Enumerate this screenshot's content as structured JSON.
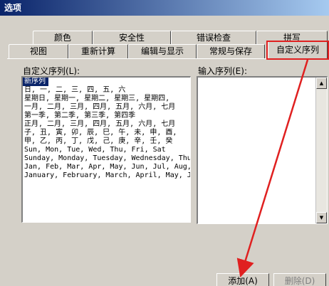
{
  "window": {
    "title": "选项"
  },
  "tabs_row1": [
    "颜色",
    "安全性",
    "错误检查",
    "拼写"
  ],
  "tabs_row2": [
    "视图",
    "重新计算",
    "编辑与显示",
    "常规与保存",
    "自定义序列"
  ],
  "custom_lists": {
    "label": "自定义序列(L):",
    "items": [
      "新序列",
      "日, 一, 二, 三, 四, 五, 六",
      "星期日, 星期一, 星期二, 星期三, 星期四,",
      "一月, 二月, 三月, 四月, 五月, 六月, 七月",
      "第一季, 第二季, 第三季, 第四季",
      "正月, 二月, 三月, 四月, 五月, 六月, 七月",
      "子, 丑, 寅, 卯, 辰, 巳, 午, 未, 申, 酉,",
      "甲, 乙, 丙, 丁, 戊, 己, 庚, 辛, 壬, 癸",
      "Sun, Mon, Tue, Wed, Thu, Fri, Sat",
      "Sunday, Monday, Tuesday, Wednesday, Thu",
      "Jan, Feb, Mar, Apr, May, Jun, Jul, Aug,",
      "January, February, March, April, May, J"
    ]
  },
  "input_list": {
    "label": "输入序列(E):"
  },
  "buttons": {
    "add": "添加(A)",
    "delete": "删除(D)"
  },
  "colors": {
    "annotation": "#e02020",
    "selection": "#0a246a",
    "dialog": "#d4d0c8"
  }
}
